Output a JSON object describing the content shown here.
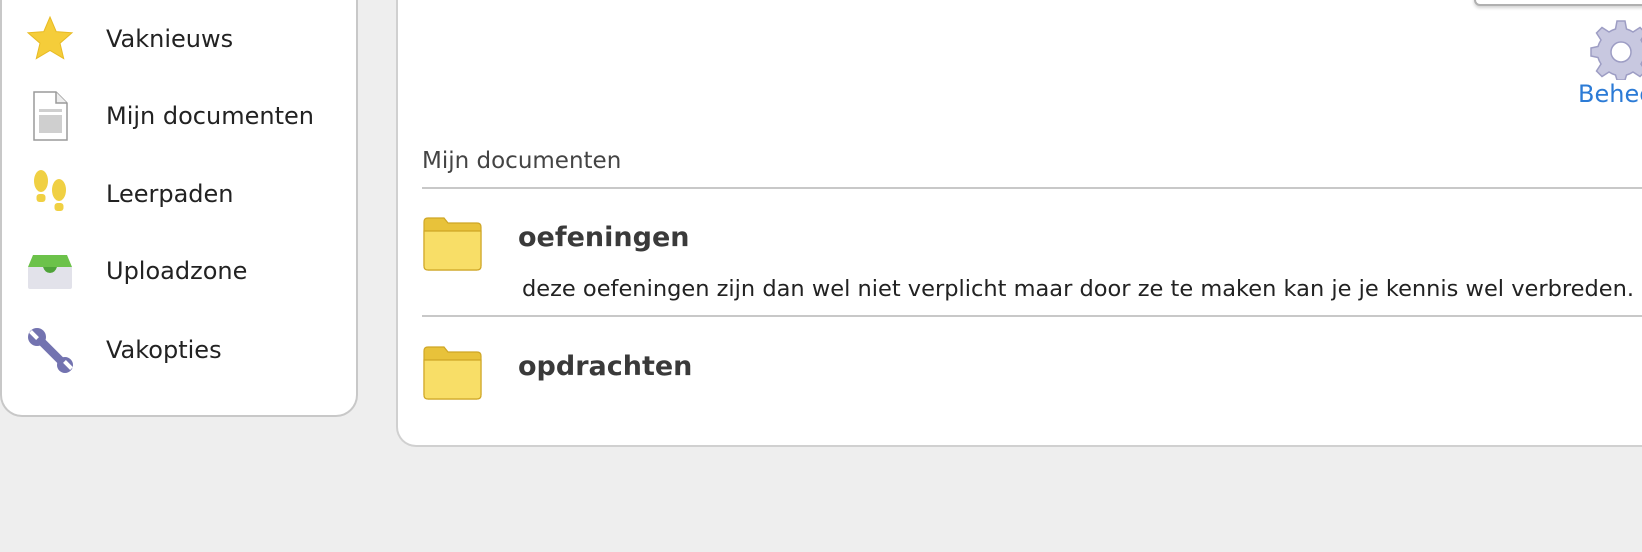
{
  "sidebar": {
    "items": [
      {
        "label": "Vaknieuws",
        "icon": "star-icon"
      },
      {
        "label": "Mijn documenten",
        "icon": "document-icon"
      },
      {
        "label": "Leerpaden",
        "icon": "footprints-icon"
      },
      {
        "label": "Uploadzone",
        "icon": "inbox-tray-icon"
      },
      {
        "label": "Vakopties",
        "icon": "wrench-icon"
      }
    ]
  },
  "main": {
    "manage": {
      "label": "Beheer",
      "icon": "gear-icon"
    },
    "section_title": "Mijn documenten",
    "folders": [
      {
        "name": "oefeningen",
        "description": "deze oefeningen zijn dan wel niet verplicht maar door ze te maken kan je je kennis wel verbreden.",
        "icon": "folder-icon"
      },
      {
        "name": "opdrachten",
        "description": "",
        "icon": "folder-icon"
      }
    ]
  },
  "colors": {
    "link": "#2c7bd6",
    "folder": "#f6d85a",
    "star": "#f5cd3a",
    "wrench": "#7373b0",
    "background": "#eeeeee"
  }
}
